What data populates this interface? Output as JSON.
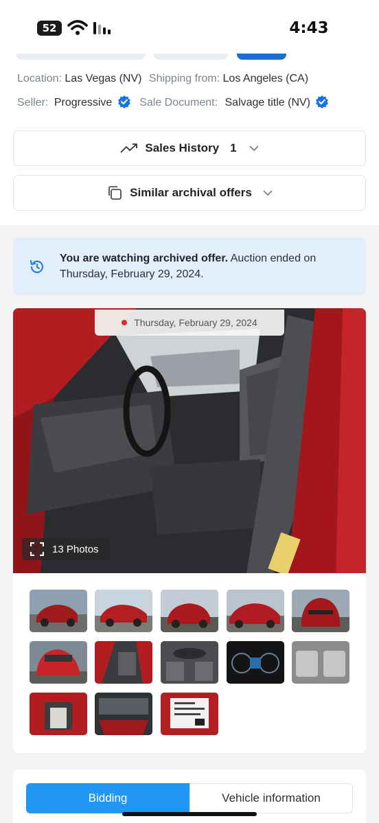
{
  "status_bar": {
    "battery": "52",
    "time": "4:43"
  },
  "details": {
    "location_label": "Location:",
    "location_value": "Las Vegas (NV)",
    "shipping_label": "Shipping from:",
    "shipping_value": "Los Angeles (CA)",
    "seller_label": "Seller:",
    "seller_value": "Progressive",
    "sale_doc_label": "Sale Document:",
    "sale_doc_value": "Salvage title (NV)"
  },
  "sales_history": {
    "label": "Sales History",
    "count": "1"
  },
  "similar_offers": {
    "label": "Similar archival offers"
  },
  "banner": {
    "bold": "You are watching archived offer.",
    "text": " Auction ended on Thursday, February 29, 2024."
  },
  "gallery": {
    "date": "Thursday, February 29, 2024",
    "photo_count": "13 Photos"
  },
  "tabs": {
    "bidding": "Bidding",
    "vehicle_info": "Vehicle information"
  },
  "colors": {
    "accent": "#2196f3",
    "verified": "#1a73e8",
    "banner_bg": "#e3eefb",
    "car_red": "#a3171c"
  }
}
